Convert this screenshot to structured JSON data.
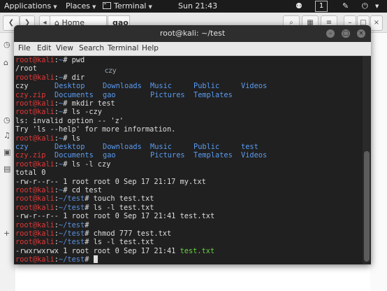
{
  "topbar": {
    "applications": "Applications",
    "places": "Places",
    "terminal": "Terminal",
    "clock": "Sun 21:43",
    "workspace": "1"
  },
  "filemanager": {
    "home_label": "Home",
    "current_folder": "gao",
    "ghost_label": "czy"
  },
  "terminal": {
    "title": "root@kali: ~/test",
    "menu": [
      "File",
      "Edit",
      "View",
      "Search",
      "Terminal",
      "Help"
    ],
    "prompt_user": "root@kali",
    "lines": [
      {
        "path": "~",
        "cmd": "pwd"
      },
      {
        "out": "/root"
      },
      {
        "path": "~",
        "cmd": "dir"
      },
      {
        "cols": [
          "czy",
          "Desktop",
          "Downloads",
          "Music",
          "Public",
          "Videos"
        ]
      },
      {
        "cols": [
          "czy.zip",
          "Documents",
          "gao",
          "Pictures",
          "Templates"
        ]
      },
      {
        "path": "~",
        "cmd": "mkdir test"
      },
      {
        "path": "~",
        "cmd": "ls -czy"
      },
      {
        "out": "ls: invalid option -- 'z'"
      },
      {
        "out": "Try 'ls --help' for more information."
      },
      {
        "path": "~",
        "cmd": "ls"
      },
      {
        "cols": [
          "czy",
          "Desktop",
          "Downloads",
          "Music",
          "Public",
          "test"
        ]
      },
      {
        "cols": [
          "czy.zip",
          "Documents",
          "gao",
          "Pictures",
          "Templates",
          "Videos"
        ]
      },
      {
        "path": "~",
        "cmd": "ls -l czy"
      },
      {
        "out": "total 0"
      },
      {
        "out": "-rw-r--r-- 1 root root 0 Sep 17 21:17 my.txt"
      },
      {
        "path": "~",
        "cmd": "cd test"
      },
      {
        "path": "~/test",
        "cmd": "touch test.txt"
      },
      {
        "path": "~/test",
        "cmd": "ls -l test.txt"
      },
      {
        "out": "-rw-r--r-- 1 root root 0 Sep 17 21:41 test.txt"
      },
      {
        "path": "~/test",
        "cmd": ""
      },
      {
        "path": "~/test",
        "cmd": "chmod 777 test.txt"
      },
      {
        "path": "~/test",
        "cmd": "ls -l test.txt"
      },
      {
        "out_prefix": "-rwxrwxrwx 1 root root 0 Sep 17 21:41 ",
        "out_file": "test.txt"
      },
      {
        "path": "~/test",
        "cmd": ""
      }
    ]
  }
}
